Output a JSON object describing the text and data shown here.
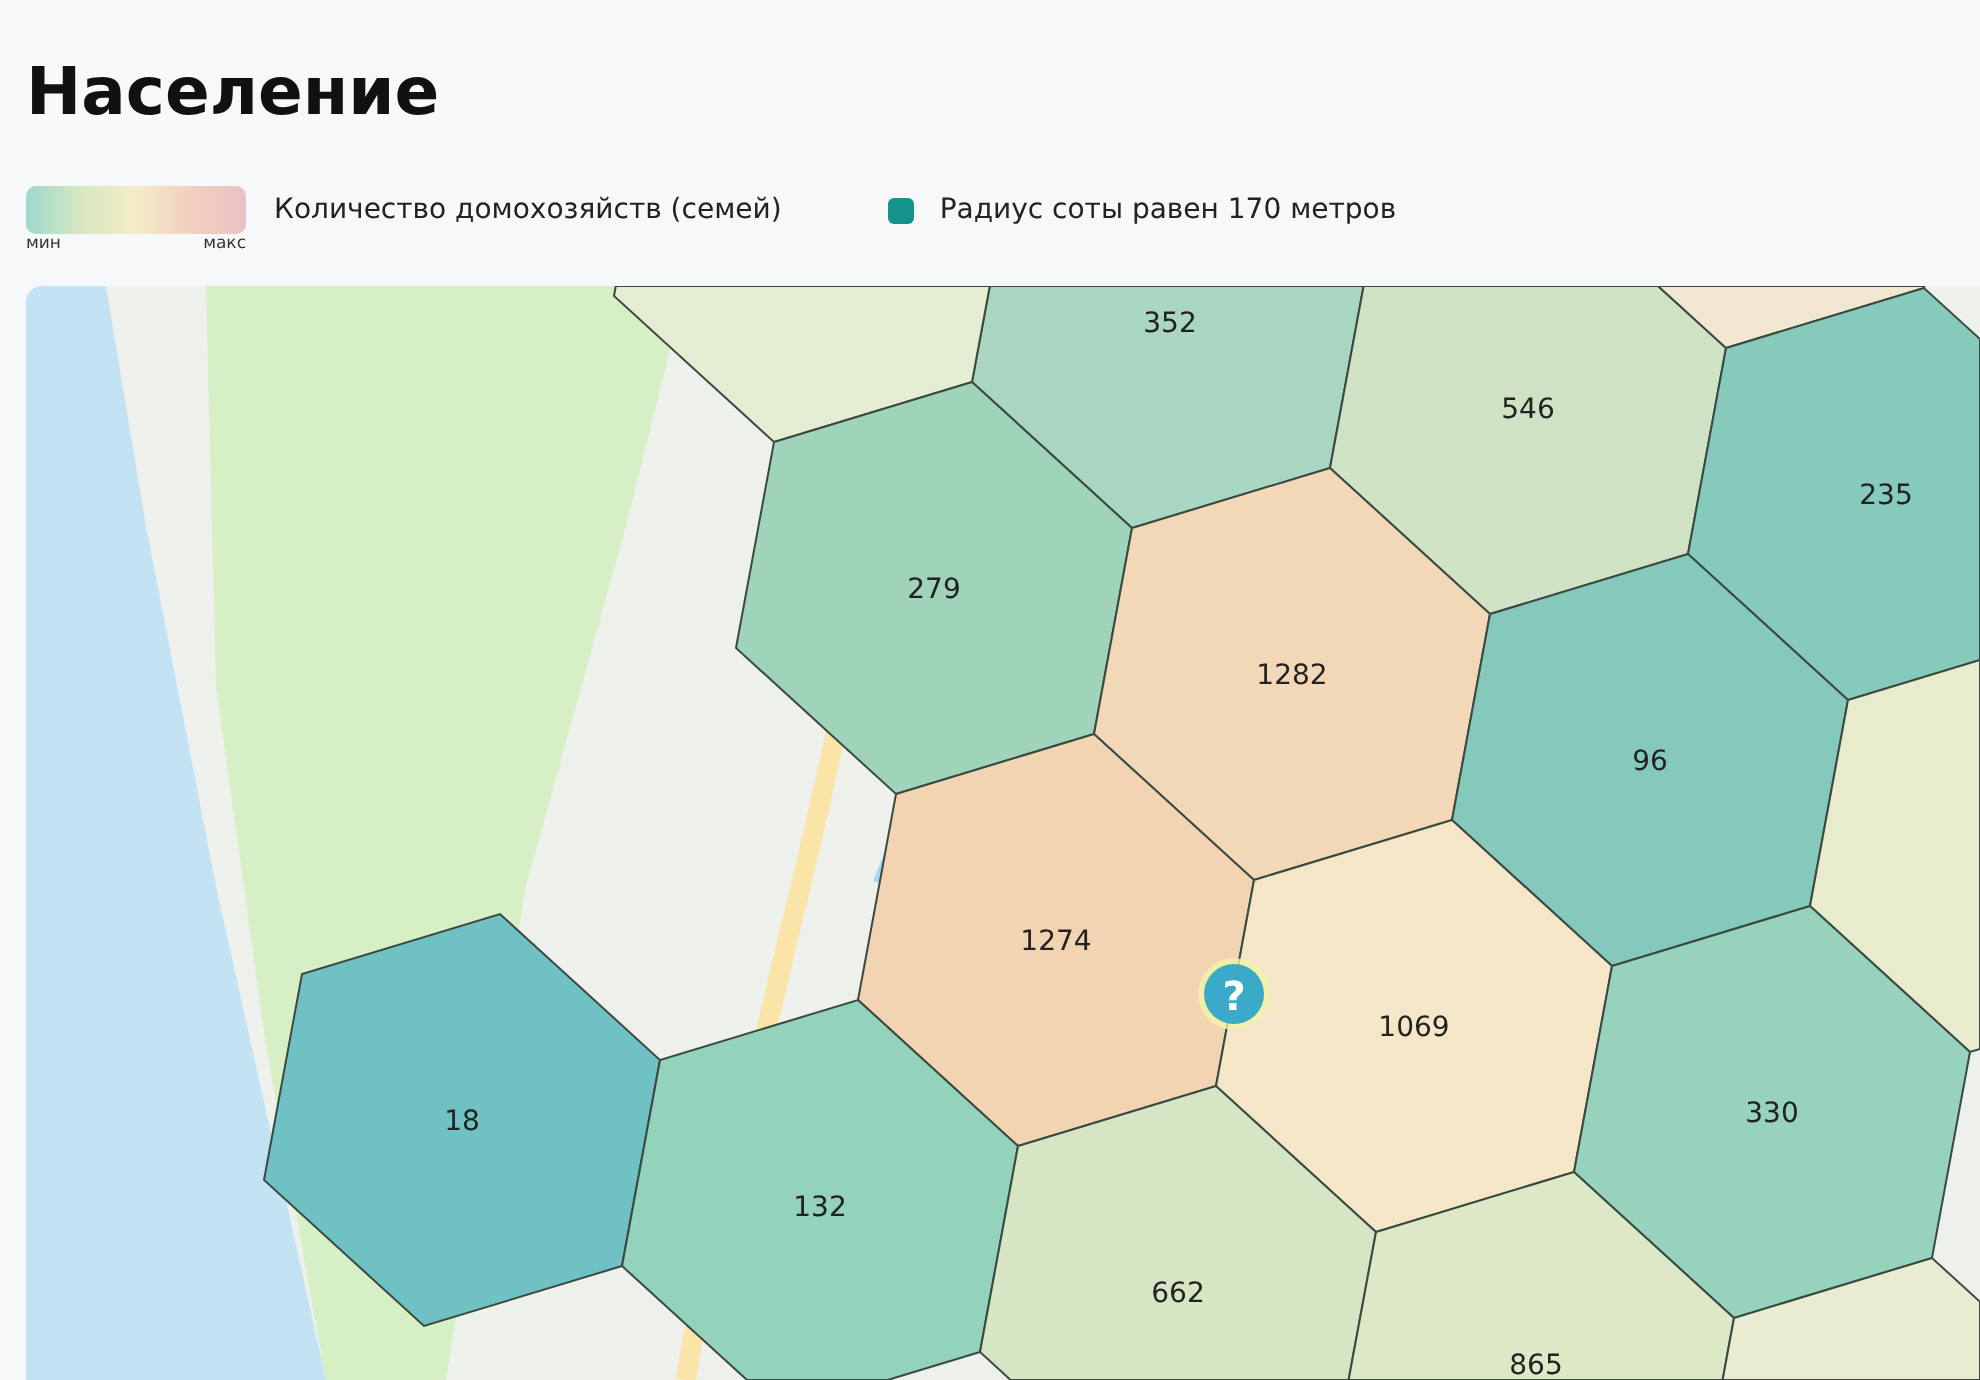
{
  "title": "Население",
  "legend": {
    "gradient": {
      "min_label": "мин",
      "max_label": "макс"
    },
    "gradient_caption": "Количество домохозяйств (семей)",
    "swatch_caption": "Радиус соты равен 170 метров"
  },
  "map": {
    "hexes": [
      {
        "value": "352",
        "color": "#a9d6c0"
      },
      {
        "color": "#e4ecd2"
      },
      {
        "value": "546",
        "color": "#cfe2c4"
      },
      {
        "color": "#f1e6cf"
      },
      {
        "value": "235",
        "color": "#86cabb"
      },
      {
        "value": "279",
        "color": "#9fd3ba"
      },
      {
        "value": "1282",
        "color": "#f3d8b8"
      },
      {
        "value": "96",
        "color": "#84c9bb"
      },
      {
        "color": "#e8ebcc"
      },
      {
        "value": "1274",
        "color": "#f3d4b2"
      },
      {
        "value": "1069",
        "color": "#f4e6c6"
      },
      {
        "value": "18",
        "color": "#70c1c4"
      },
      {
        "value": "330",
        "color": "#97d2bc"
      },
      {
        "value": "132",
        "color": "#93d2bb"
      },
      {
        "value": "662",
        "color": "#d6e6c4"
      },
      {
        "value": "865",
        "color": "#dde8c6"
      },
      {
        "color": "#e9ecd0"
      }
    ],
    "marker": {
      "label": "?"
    }
  }
}
